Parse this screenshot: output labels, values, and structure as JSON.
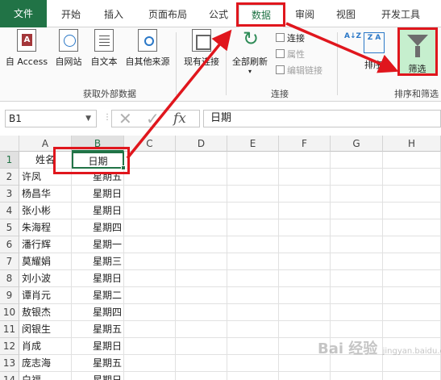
{
  "tabs": [
    {
      "label": "文件",
      "active": false
    },
    {
      "label": "开始",
      "active": false
    },
    {
      "label": "插入",
      "active": false
    },
    {
      "label": "页面布局",
      "active": false
    },
    {
      "label": "公式",
      "active": false
    },
    {
      "label": "数据",
      "active": true
    },
    {
      "label": "审阅",
      "active": false
    },
    {
      "label": "视图",
      "active": false
    },
    {
      "label": "开发工具",
      "active": false
    }
  ],
  "ribbon": {
    "external": {
      "group_label": "获取外部数据",
      "buttons": [
        {
          "label": "自 Access",
          "icon": "access-icon"
        },
        {
          "label": "自网站",
          "icon": "web-globe-icon"
        },
        {
          "label": "自文本",
          "icon": "text-file-icon"
        },
        {
          "label": "自其他来源",
          "icon": "other-sources-icon"
        }
      ]
    },
    "existing_connections": {
      "label": "现有连接",
      "icon": "existing-connections-icon"
    },
    "connections": {
      "group_label": "连接",
      "refresh_all": "全部刷新",
      "connections_btn": "连接",
      "properties_btn": "属性",
      "edit_links_btn": "编辑链接"
    },
    "sort_filter": {
      "group_label": "排序和筛选",
      "sort_asc": "A↓Z",
      "sort_box": "Z A",
      "sort_label": "排序",
      "filter_label": "筛选"
    }
  },
  "formula_bar": {
    "name_box": "B1",
    "fx": "fx",
    "value": "日期"
  },
  "sheet": {
    "columns": [
      "A",
      "B",
      "C",
      "D",
      "E",
      "F",
      "G",
      "H"
    ],
    "selected_column": "B",
    "rows": [
      {
        "n": "1",
        "a": "姓名",
        "b": "日期"
      },
      {
        "n": "2",
        "a": "许凤",
        "b": "星期五"
      },
      {
        "n": "3",
        "a": "杨昌华",
        "b": "星期日"
      },
      {
        "n": "4",
        "a": "张小彬",
        "b": "星期日"
      },
      {
        "n": "5",
        "a": "朱海程",
        "b": "星期四"
      },
      {
        "n": "6",
        "a": "潘行辉",
        "b": "星期一"
      },
      {
        "n": "7",
        "a": "莫耀娟",
        "b": "星期三"
      },
      {
        "n": "8",
        "a": "刘小波",
        "b": "星期日"
      },
      {
        "n": "9",
        "a": "谭肖元",
        "b": "星期二"
      },
      {
        "n": "10",
        "a": "敖银杰",
        "b": "星期四"
      },
      {
        "n": "11",
        "a": "闵银生",
        "b": "星期五"
      },
      {
        "n": "12",
        "a": "肖成",
        "b": "星期日"
      },
      {
        "n": "13",
        "a": "庞志海",
        "b": "星期五"
      },
      {
        "n": "14",
        "a": "白福",
        "b": "星期日"
      }
    ],
    "active_cell": "B1"
  },
  "colors": {
    "accent": "#217346",
    "annotation": "#e0161d",
    "filter_highlight": "#c6efce"
  },
  "watermark": {
    "text": "Bai 经验",
    "sub": "jingyan.baidu.com"
  }
}
